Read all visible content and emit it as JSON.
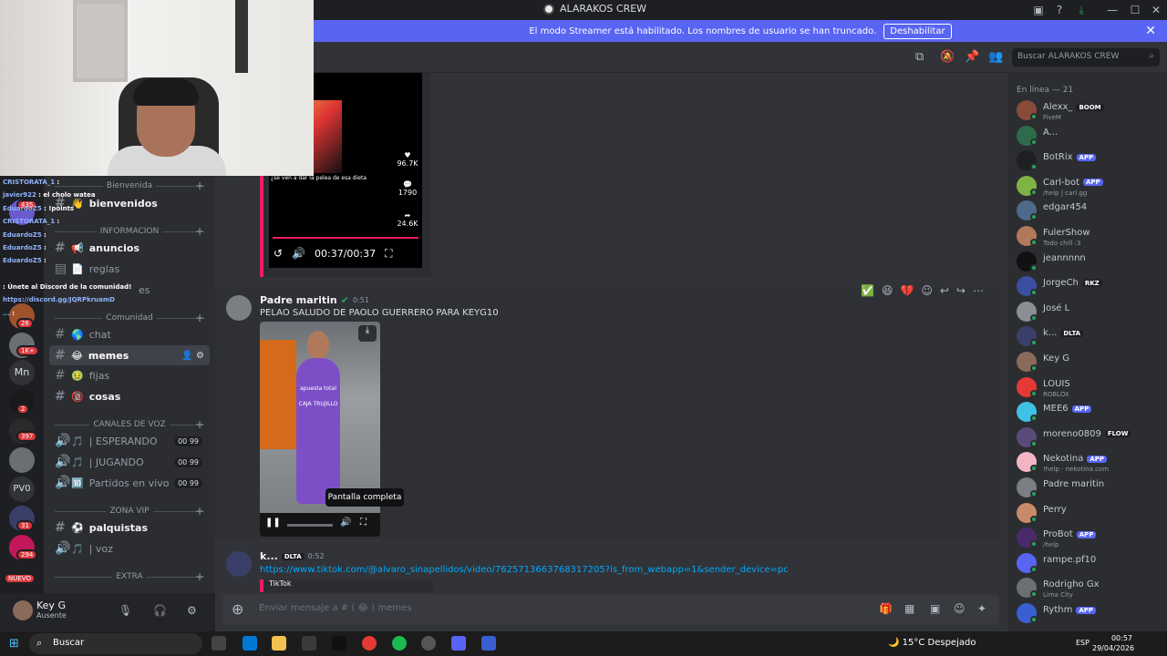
{
  "window": {
    "title": "ALARAKOS CREW"
  },
  "streamer_bar": {
    "message": "El modo Streamer está habilitado. Los nombres de usuario se han truncado.",
    "button": "Deshabilitar"
  },
  "search": {
    "placeholder": "Buscar ALARAKOS CREW"
  },
  "server_rail": {
    "badges": [
      "435",
      "26",
      "1K+",
      "2",
      "397",
      "31",
      "294"
    ],
    "labels": {
      "mn": "Mn",
      "pv0": "PV0",
      "nuevo": "NUEVO"
    }
  },
  "channels": {
    "cat_bienvenida": "Bienvenida",
    "bienvenidos": "bienvenidos",
    "cat_informacion": "INFORMACION",
    "anuncios": "anuncios",
    "reglas": "reglas",
    "reglas_extra": "es",
    "cat_comunidad": "Comunidad",
    "chat": "chat",
    "memes": "memes",
    "fijas": "fijas",
    "cosas": "cosas",
    "cat_voz": "CANALES DE VOZ",
    "esperando": "| ESPERANDO",
    "jugando": "| JUGANDO",
    "partidos": "Partidos en vivo",
    "voice_count_a": "00",
    "voice_count_b": "99",
    "cat_zona_vip": "ZONA VIP",
    "palquistas": "palquistas",
    "voz": "| voz",
    "cat_extra": "EXTRA"
  },
  "user_panel": {
    "name": "Key G",
    "status": "Ausente"
  },
  "tiktok_embed": {
    "likes": "96.7K",
    "comments": "1790",
    "shares": "24.6K",
    "time": "00:37/00:37",
    "caption": "¿se ven a dar la pelea de esa dieta"
  },
  "messages": [
    {
      "author": "Padre maritin",
      "time": "0:51",
      "text": "PELAO SALUDO DE PAOLO GUERRERO PARA KEYG10"
    },
    {
      "author": "k...",
      "tag": "DLTA",
      "time": "0:52",
      "text": "https://www.tiktok.com/@alvaro_sinapellidos/video/7625713663768317205?is_from_webapp=1&sender_device=pc",
      "embed_provider": "TikTok"
    }
  ],
  "video": {
    "tooltip": "Pantalla completa",
    "shirt_text_1": "apuesta total",
    "shirt_text_2": "CAJA TRUJILLO"
  },
  "composer": {
    "placeholder": "Enviar mensaje a # ( 😂 ) memes"
  },
  "members": {
    "heading": "En línea — 21",
    "list": [
      {
        "name": "Alexx_",
        "tag": "BOOM",
        "sub": "FiveM",
        "color": "#8b4b3a"
      },
      {
        "name": "A...",
        "tag": "",
        "sub": "",
        "color": "#2f6b4a"
      },
      {
        "name": "BotRix",
        "tag": "APP",
        "sub": "",
        "color": "#1e1f22"
      },
      {
        "name": "Carl-bot",
        "tag": "APP",
        "sub": "/help | carl.gg",
        "color": "#7fb342"
      },
      {
        "name": "edgar454",
        "tag": "",
        "sub": "",
        "color": "#4e6a8a"
      },
      {
        "name": "FulerShow",
        "tag": "",
        "sub": "Todo chill :3",
        "color": "#b3785a"
      },
      {
        "name": "jeannnnn",
        "tag": "",
        "sub": "",
        "color": "#111"
      },
      {
        "name": "JorgeCh",
        "tag": "RKZ",
        "sub": "",
        "color": "#3a4fa0"
      },
      {
        "name": "José L",
        "tag": "",
        "sub": "",
        "color": "#8a8f94"
      },
      {
        "name": "k...",
        "tag": "DLTA",
        "sub": "",
        "color": "#3a3f6a"
      },
      {
        "name": "Key G",
        "tag": "",
        "sub": "",
        "color": "#8a6a5a"
      },
      {
        "name": "LOUIS",
        "tag": "",
        "sub": "ROBLOX",
        "color": "#e53935"
      },
      {
        "name": "MEE6",
        "tag": "APP",
        "sub": "",
        "color": "#3fc1e6"
      },
      {
        "name": "moreno0809",
        "tag": "FLOW",
        "sub": "",
        "color": "#5a4a7a"
      },
      {
        "name": "Nekotina",
        "tag": "APP",
        "sub": "!help · nekotina.com",
        "color": "#f2b5c6"
      },
      {
        "name": "Padre maritin",
        "tag": "",
        "sub": "",
        "color": "#7a7f84"
      },
      {
        "name": "Perry",
        "tag": "",
        "sub": "",
        "color": "#c98a6a"
      },
      {
        "name": "ProBot",
        "tag": "APP",
        "sub": "/help",
        "color": "#4a2a6a"
      },
      {
        "name": "rampe.pf10",
        "tag": "",
        "sub": "",
        "color": "#5865f2"
      },
      {
        "name": "Rodrigho Gx",
        "tag": "",
        "sub": "Lima City",
        "color": "#6a6f74"
      },
      {
        "name": "Rythm",
        "tag": "APP",
        "sub": "",
        "color": "#3a5fd0"
      }
    ]
  },
  "overlay_chat": [
    {
      "user": "CRISTORATA_1",
      "msg": ":"
    },
    {
      "user": "javier922",
      "msg": ": el cholo watea"
    },
    {
      "user": "EduardoZ5",
      "msg": ": !points"
    },
    {
      "user": "CRISTORATA_1",
      "msg": ":"
    },
    {
      "user": "EduardoZ5",
      "msg": ":"
    },
    {
      "user": "EduardoZ5",
      "msg": ":"
    },
    {
      "user": "EduardoZ5",
      "msg": ":"
    },
    {
      "user": "",
      "msg": ": Únete al Discord de la comunidad!"
    },
    {
      "user": "https://discord.gg/JQRPkruamD",
      "msg": ""
    },
    {
      "user": "...",
      "msg": ":"
    }
  ],
  "taskbar": {
    "search": "Buscar",
    "weather": "15°C  Despejado",
    "lang": "ESP",
    "time": "00:57",
    "date": "29/04/2026"
  },
  "colors": {
    "accent": "#5865f2",
    "tiktok_border": "#e91e63",
    "link": "#00a8fc"
  }
}
